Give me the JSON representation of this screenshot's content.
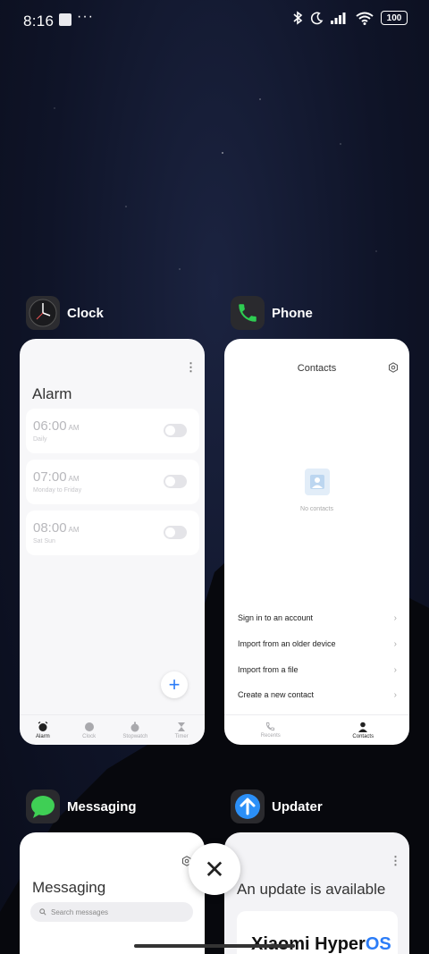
{
  "status_bar": {
    "time": "8:16",
    "more": "···",
    "battery": "100"
  },
  "recents": [
    {
      "app_name": "Clock",
      "screen": {
        "title": "Alarm",
        "alarms": [
          {
            "time": "06:00",
            "ampm": "AM",
            "repeat": "Daily"
          },
          {
            "time": "07:00",
            "ampm": "AM",
            "repeat": "Monday to Friday"
          },
          {
            "time": "08:00",
            "ampm": "AM",
            "repeat": "Sat Sun"
          }
        ],
        "tabs": [
          "Alarm",
          "Clock",
          "Stopwatch",
          "Timer"
        ]
      }
    },
    {
      "app_name": "Phone",
      "screen": {
        "title": "Contacts",
        "empty_text": "No contacts",
        "actions": [
          "Sign in to an account",
          "Import from an older device",
          "Import from a file",
          "Create a new contact"
        ],
        "tabs": [
          "Recents",
          "Contacts"
        ]
      }
    },
    {
      "app_name": "Messaging",
      "screen": {
        "title": "Messaging",
        "search_placeholder": "Search messages"
      }
    },
    {
      "app_name": "Updater",
      "screen": {
        "title": "An update is available",
        "brand": "Xiaomi Hyper",
        "brand_os": "OS"
      }
    }
  ],
  "colors": {
    "accent": "#2b7cf7",
    "phone_green": "#2ecc52",
    "messaging_green": "#3fcf55"
  }
}
